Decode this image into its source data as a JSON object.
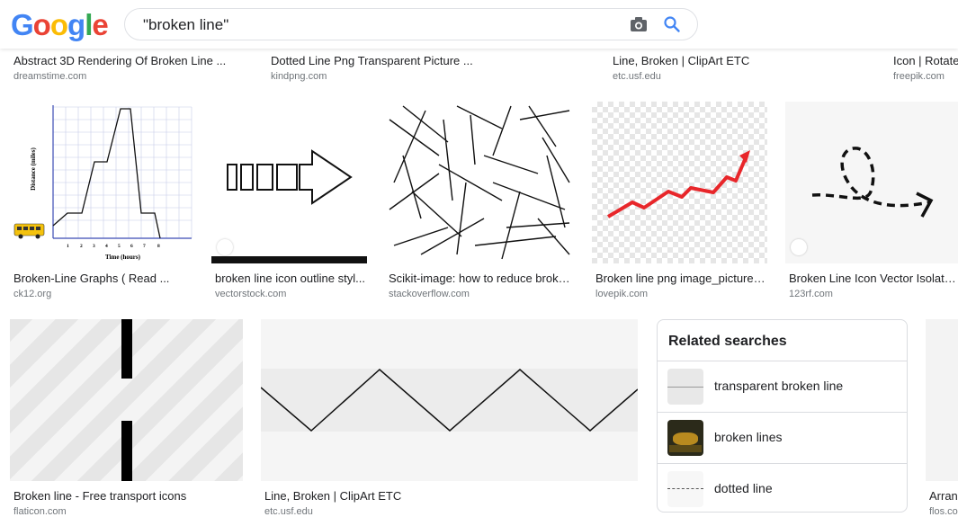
{
  "header": {
    "logo_letters": [
      {
        "ch": "G",
        "color": "#4285F4"
      },
      {
        "ch": "o",
        "color": "#EA4335"
      },
      {
        "ch": "o",
        "color": "#FBBC05"
      },
      {
        "ch": "g",
        "color": "#4285F4"
      },
      {
        "ch": "l",
        "color": "#34A853"
      },
      {
        "ch": "e",
        "color": "#EA4335"
      }
    ],
    "query": "\"broken line\""
  },
  "top_row": [
    {
      "title": "Abstract 3D Rendering Of Broken Line ...",
      "source": "dreamstime.com"
    },
    {
      "title": "Dotted Line Png Transparent Picture ...",
      "source": "kindpng.com"
    },
    {
      "title": "Line, Broken | ClipArt ETC",
      "source": "etc.usf.edu"
    },
    {
      "title": "Icon | Rotated",
      "source": "freepik.com"
    }
  ],
  "middle_row": [
    {
      "title": "Broken-Line Graphs ( Read ...",
      "source": "ck12.org"
    },
    {
      "title": "broken line icon outline styl...",
      "source": "vectorstock.com"
    },
    {
      "title": "Scikit-image: how to reduce broken...",
      "source": "stackoverflow.com"
    },
    {
      "title": "Broken line png image_picture fr...",
      "source": "lovepik.com"
    },
    {
      "title": "Broken Line Icon Vector Isolated...",
      "source": "123rf.com"
    }
  ],
  "graph_thumb": {
    "ylabel": "Distance (miles)",
    "xlabel": "Time (hours)",
    "ticks": [
      "1",
      "2",
      "3",
      "4",
      "5",
      "6",
      "7",
      "8"
    ]
  },
  "bottom_row": [
    {
      "title": "Broken line - Free transport icons",
      "source": "flaticon.com"
    },
    {
      "title": "Line, Broken | ClipArt ETC",
      "source": "etc.usf.edu"
    },
    {
      "title": "Arrang",
      "source": "flos.co"
    }
  ],
  "related": {
    "title": "Related searches",
    "items": [
      {
        "label": "transparent broken line"
      },
      {
        "label": "broken lines"
      },
      {
        "label": "dotted line"
      }
    ]
  },
  "colors": {
    "accent_red": "#e8262a",
    "link_gray": "#70757a"
  },
  "icons": [
    "camera-icon",
    "search-icon",
    "tag-icon"
  ]
}
